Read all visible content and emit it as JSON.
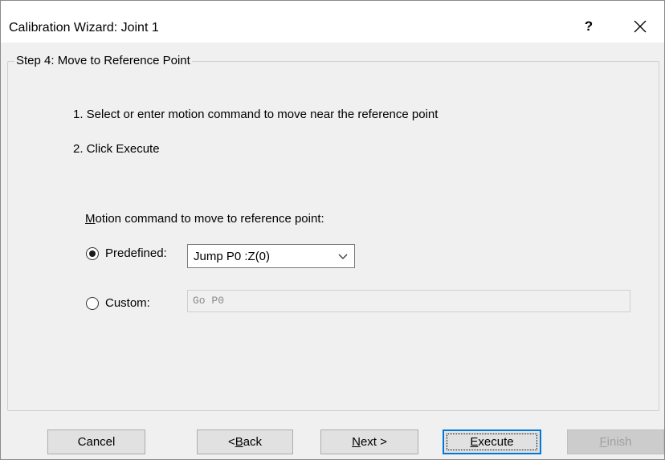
{
  "window": {
    "title": "Calibration Wizard: Joint 1",
    "help_label": "?"
  },
  "step": {
    "legend": "Step 4: Move to Reference Point",
    "instructions": [
      "1. Select or enter motion command to move near the reference point",
      "2. Click Execute"
    ]
  },
  "motion": {
    "label_accel": "M",
    "label_rest": "otion command to move to reference point:",
    "predefined_label": "Predefined:",
    "predefined_selected": true,
    "predefined_value": "Jump P0 :Z(0)",
    "custom_label": "Custom:",
    "custom_selected": false,
    "custom_value": "Go P0"
  },
  "buttons": {
    "cancel": "Cancel",
    "back_prefix": "< ",
    "back_accel": "B",
    "back_rest": "ack",
    "next_accel": "N",
    "next_rest": "ext >",
    "execute_accel": "E",
    "execute_rest": "xecute",
    "finish_accel": "F",
    "finish_rest": "inish"
  },
  "icons": {
    "close": "close-icon",
    "dropdown": "chevron-down-icon"
  }
}
